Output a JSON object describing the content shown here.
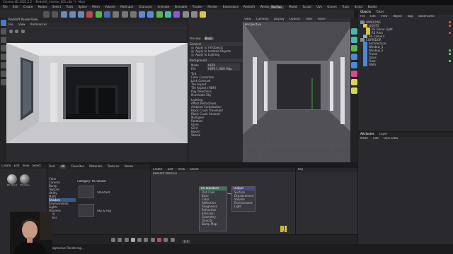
{
  "window": {
    "title": "Cinema 4D 2023.2.2 - [Redshift_Interior_001.c4d *] - Main"
  },
  "menu": [
    "File",
    "Edit",
    "Create",
    "Modes",
    "Select",
    "Tools",
    "Spline",
    "Mesh",
    "Volume",
    "MoGraph",
    "Character",
    "Animate",
    "Simulate",
    "Tracker",
    "Render",
    "Extensions",
    "Redshift",
    "Window",
    "Help"
  ],
  "layouts": [
    "Startup",
    "Model",
    "Sculpt",
    "UVs",
    "Groom",
    "Track",
    "Script",
    "Nodes"
  ],
  "render_view": {
    "title": "Redshift RenderView",
    "menu": [
      "File",
      "View",
      "Preferences"
    ]
  },
  "attributes": {
    "tabs": [
      "Preview",
      "Basic"
    ],
    "section1": "General",
    "checks": [
      "Apply to All Objects",
      "Apply to Isolated Objects",
      "Apply to Lighting"
    ],
    "section2": "Background",
    "mode_label": "Mode",
    "mode_value": "HDRI",
    "file_label": "File",
    "file_value": "HDRI 1.HDR Map",
    "rows": [
      "Tint",
      "Color Correction",
      "Lock Contrast",
      "Tile Aspect",
      "Tile Aspect (HDR)",
      "Ray Directions",
      "Illuminate Sky",
      "Lighting",
      "Affect Refractions",
      "Ambient Contribution",
      "Black Crush Threshold",
      "Black Crush Amount",
      "Multiplier",
      "Rotation",
      "Glare",
      "Glint",
      "Bloom",
      "Streak"
    ]
  },
  "viewport": {
    "menu": [
      "View",
      "Cameras",
      "Display",
      "Options",
      "Filter",
      "Panel"
    ],
    "label": "Perspective"
  },
  "object_manager": {
    "tabs": [
      "Objects",
      "Takes"
    ],
    "menu": [
      "File",
      "Edit",
      "View",
      "Object",
      "Tags",
      "Bookmarks"
    ],
    "items": [
      "WINDOWS",
      "LIGHTS",
      "RS Dome Light",
      "RS Area",
      "RS Camera",
      "CORRIDOR",
      "Architecture",
      "Window_1",
      "Window_2",
      "Frame",
      "Glass",
      "Floor",
      "Walls"
    ]
  },
  "attributes_manager": {
    "tabs": [
      "Attributes",
      "Layer"
    ],
    "menu": [
      "Mode",
      "Edit",
      "User Data"
    ]
  },
  "material_manager": {
    "menu": [
      "Create",
      "Edit",
      "View",
      "Select"
    ],
    "materials": [
      "RS Standard",
      "RS Glass"
    ]
  },
  "asset_browser": {
    "tabs": [
      "Find",
      "All",
      "Favorites",
      "Materials",
      "Textures",
      "Nodes"
    ],
    "tree": [
      "Color",
      "Camera",
      "Bump",
      "Texture",
      "Utility",
      "Math",
      "Shaders",
      "Environments",
      "Lights",
      "Volumes",
      "AOV",
      "Other"
    ],
    "category": "Category: RS Shader",
    "nodes": [
      "Standard",
      "Sky & Fog"
    ]
  },
  "node_editor": {
    "menu": [
      "Create",
      "Edit",
      "View",
      "Select"
    ],
    "path": "Redshift Material",
    "node1": {
      "title": "RS Standard",
      "ports": [
        "Out Color",
        "Base",
        "Color",
        "Reflection",
        "Roughness",
        "Refraction",
        "Emission",
        "Geometry",
        "Opacity",
        "Bump Map"
      ]
    },
    "node2": {
      "title": "Output",
      "ports": [
        "Surface",
        "Displacement",
        "Volume",
        "Environment",
        "Light"
      ]
    }
  },
  "timeline": {
    "header": "Key"
  },
  "transport": {
    "frame": "0 F"
  },
  "status": {
    "text": "Progressive Rendering..."
  }
}
